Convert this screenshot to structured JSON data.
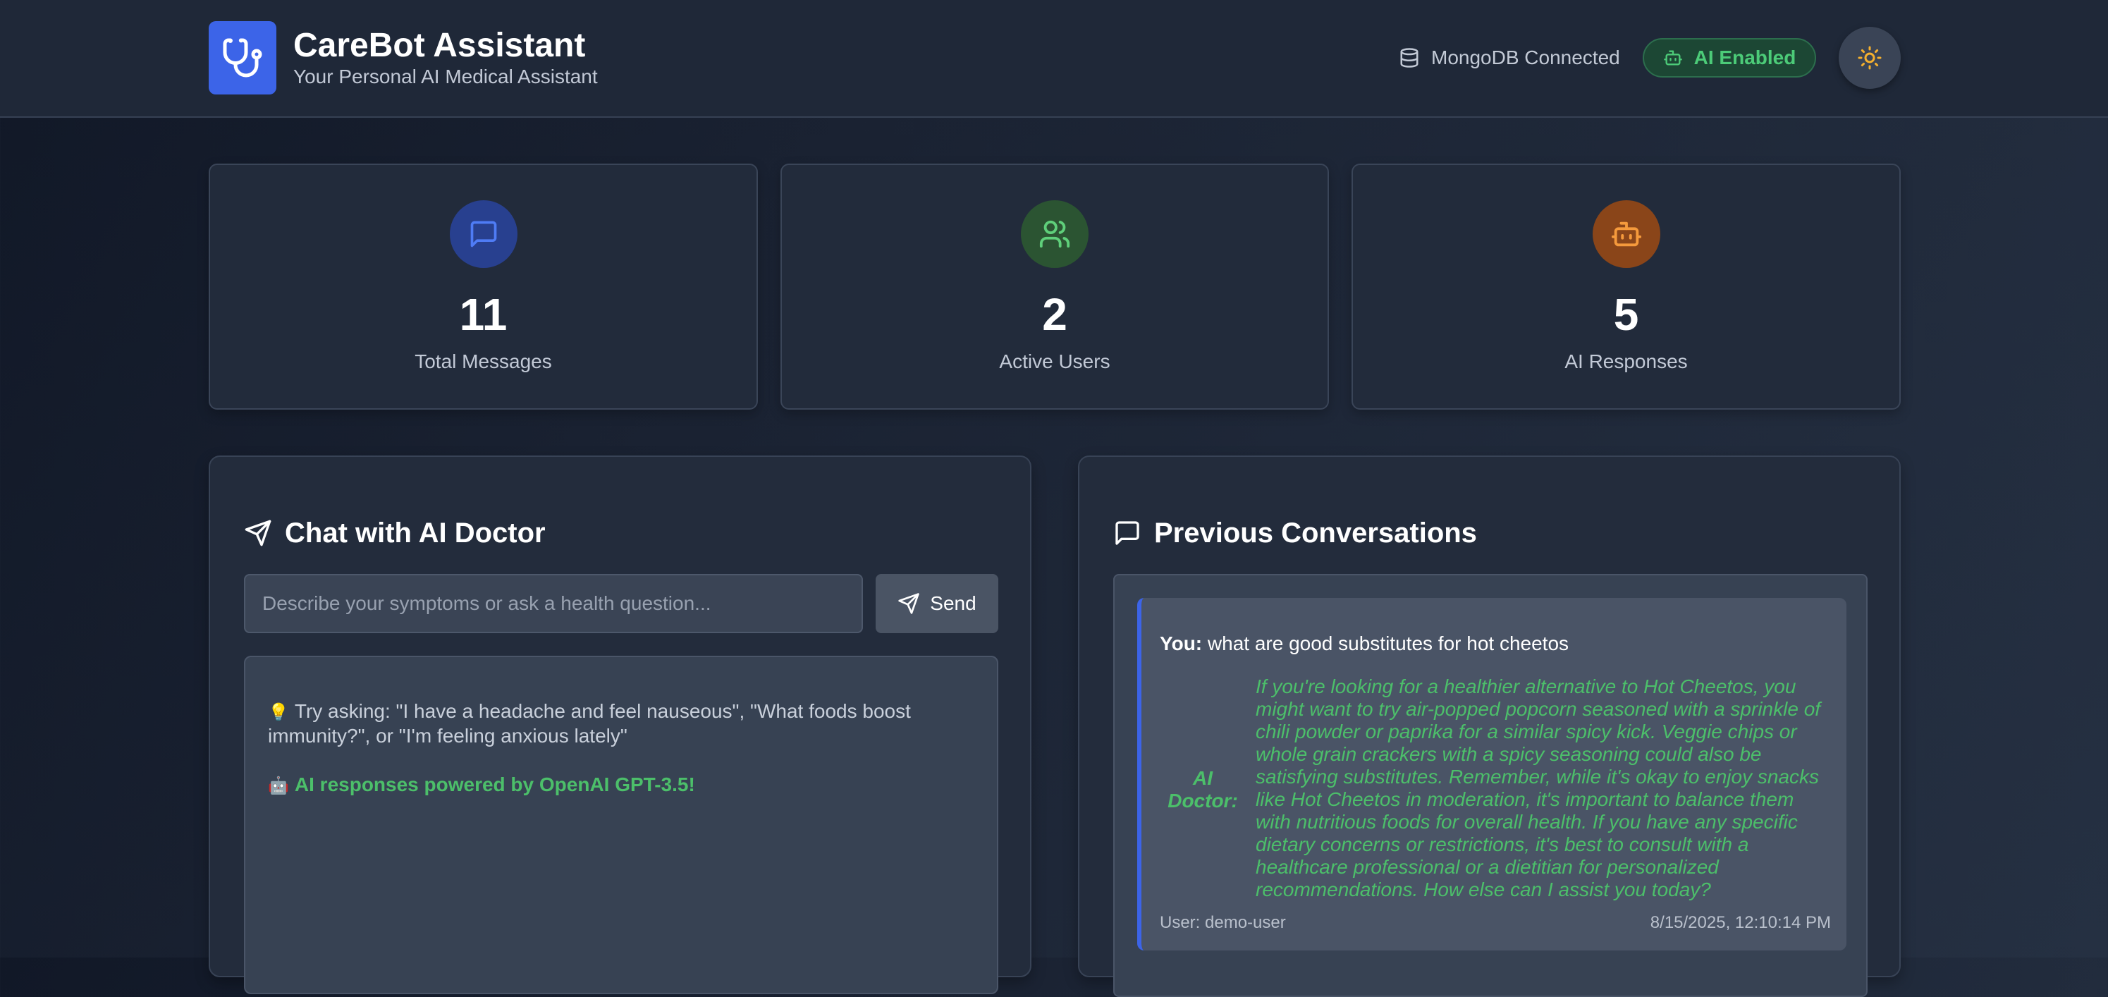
{
  "header": {
    "title": "CareBot Assistant",
    "subtitle": "Your Personal AI Medical Assistant",
    "logo_icon": "stethoscope-icon",
    "db_status": "MongoDB Connected",
    "db_icon": "database-icon",
    "ai_badge": "AI Enabled",
    "ai_badge_icon": "bot-icon",
    "theme_icon": "sun-icon"
  },
  "stats": [
    {
      "value": "11",
      "label": "Total Messages",
      "icon": "message-square-icon",
      "color": "#3b5bdb"
    },
    {
      "value": "2",
      "label": "Active Users",
      "icon": "users-icon",
      "color": "#40c057"
    },
    {
      "value": "5",
      "label": "AI Responses",
      "icon": "bot-icon",
      "color": "#fd7e14"
    }
  ],
  "chat": {
    "title": "Chat with AI Doctor",
    "title_icon": "send-icon",
    "input_placeholder": "Describe your symptoms or ask a health question...",
    "input_value": "",
    "send_label": "Send",
    "send_icon": "send-icon",
    "hint": "Try asking: \"I have a headache and feel nauseous\", \"What foods boost immunity?\", or \"I'm feeling anxious lately\"",
    "hint_icon": "lightbulb-icon",
    "powered_by": "AI responses powered by OpenAI GPT-3.5!",
    "powered_icon": "robot-emoji-icon"
  },
  "history": {
    "title": "Previous Conversations",
    "title_icon": "message-square-icon",
    "items": [
      {
        "you_label": "You:",
        "question": "what are good substitutes for hot cheetos",
        "ai_label": "AI Doctor:",
        "response": "If you're looking for a healthier alternative to Hot Cheetos, you might want to try air-popped popcorn seasoned with a sprinkle of chili powder or paprika for a similar spicy kick. Veggie chips or whole grain crackers with a spicy seasoning could also be satisfying substitutes. Remember, while it's okay to enjoy snacks like Hot Cheetos in moderation, it's important to balance them with nutritious foods for overall health. If you have any specific dietary concerns or restrictions, it's best to consult with a healthcare professional or a dietitian for personalized recommendations. How else can I assist you today?",
        "user": "User: demo-user",
        "timestamp": "8/15/2025, 12:10:14 PM"
      }
    ]
  },
  "colors": {
    "accent": "#3c64e8",
    "success": "#4cbf6a",
    "background": "#1a2232"
  }
}
